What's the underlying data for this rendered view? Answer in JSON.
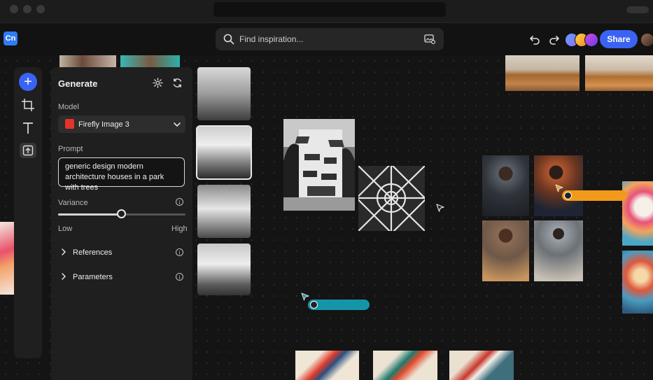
{
  "header": {
    "logo_text": "Cn",
    "search_placeholder": "Find inspiration...",
    "share_label": "Share"
  },
  "panel": {
    "title": "Generate",
    "model_label": "Model",
    "model_value": "Firefly Image 3",
    "prompt_label": "Prompt",
    "prompt_value": "generic design modern architecture houses in a park with trees",
    "variance_label": "Variance",
    "variance_low": "Low",
    "variance_high": "High",
    "variance_level": 0.5,
    "references_label": "References",
    "parameters_label": "Parameters"
  },
  "colors": {
    "accent": "#3b63f2",
    "collaborator_orange": "#f29a1a",
    "collaborator_teal": "#1595a8"
  },
  "icons": [
    "search-icon",
    "image-search-icon",
    "undo-icon",
    "redo-icon",
    "add-icon",
    "crop-icon",
    "text-icon",
    "upload-icon",
    "settings-icon",
    "refresh-icon",
    "chevron-down-icon",
    "chevron-right-icon",
    "info-icon",
    "cursor-icon"
  ]
}
